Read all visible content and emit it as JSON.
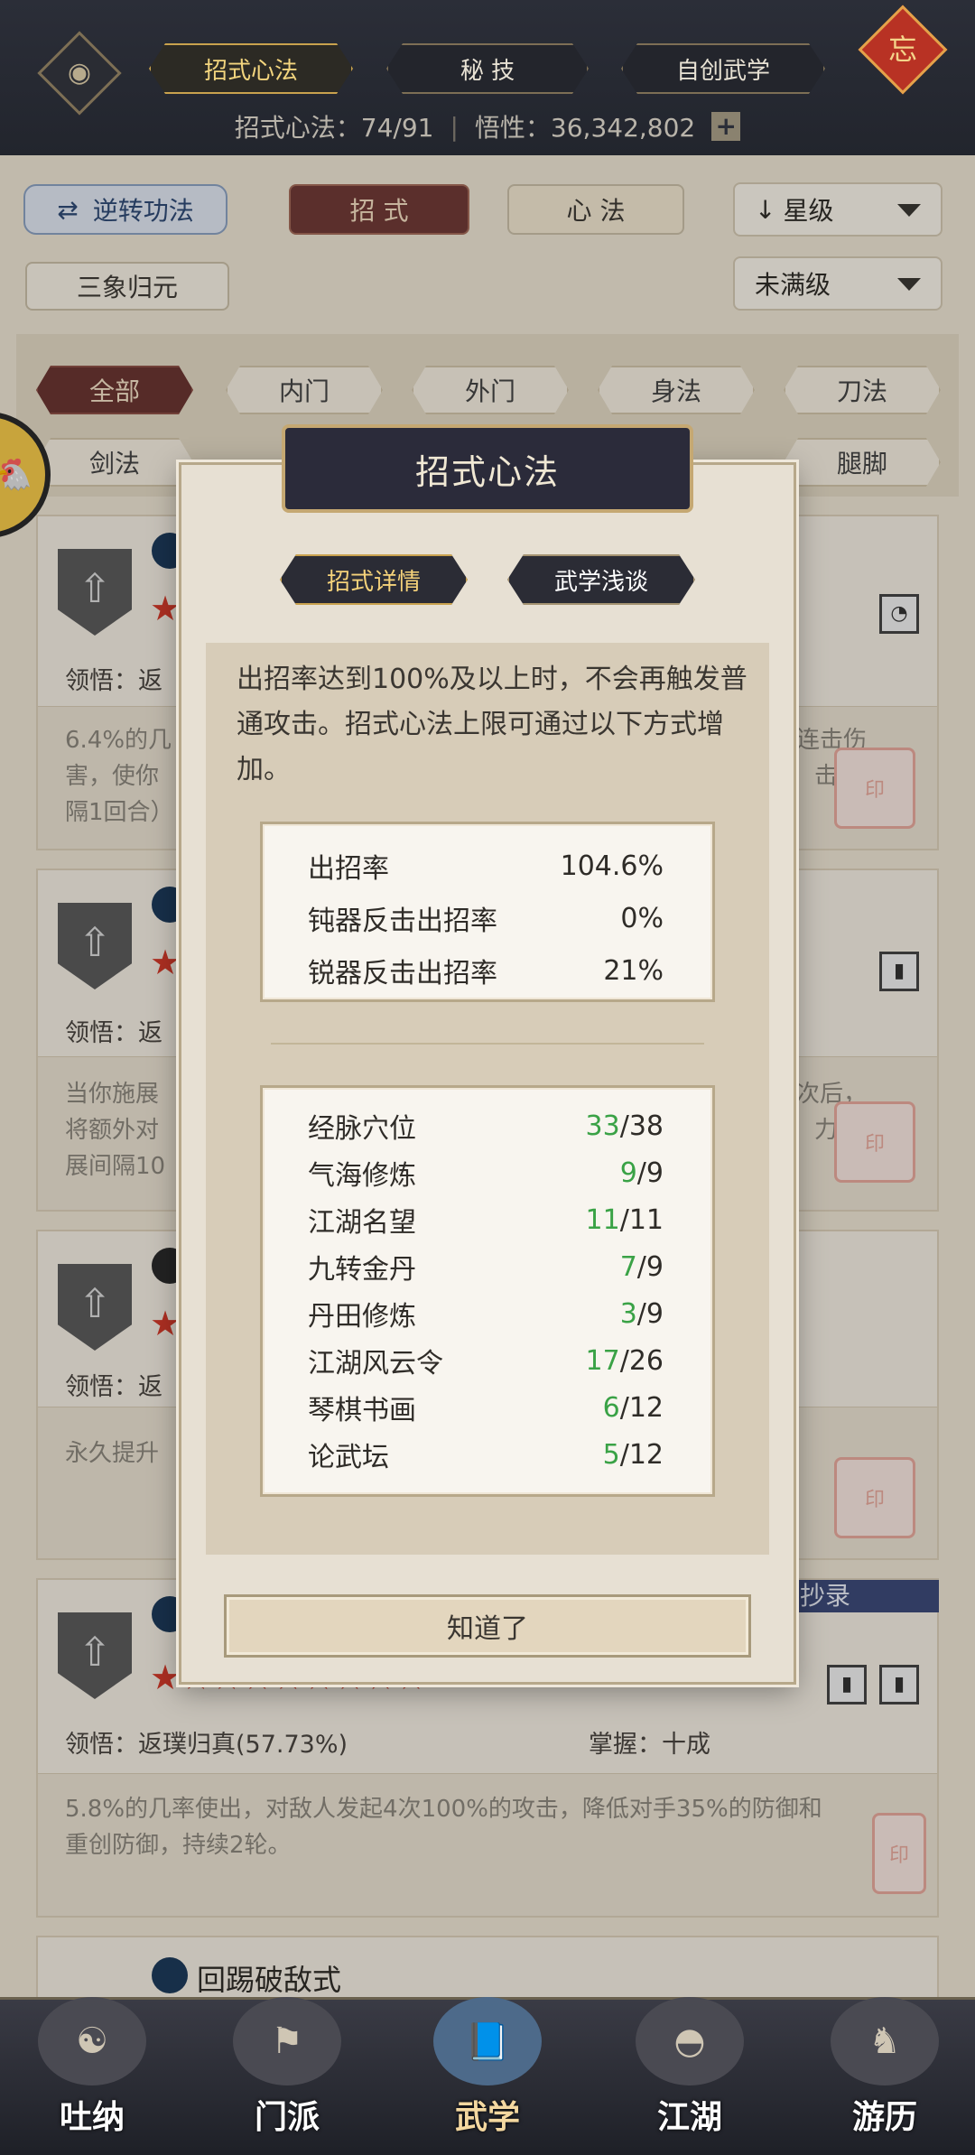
{
  "top": {
    "tabs": [
      "招式心法",
      "秘 技",
      "自创武学"
    ],
    "active_tab": "招式心法",
    "stats_label1": "招式心法：",
    "stats_value1": "74/91",
    "stats_label2": "悟性：",
    "stats_value2": "36,342,802",
    "plus": "+",
    "knot_char": "忘"
  },
  "filters": {
    "reverse_btn": "逆转功法",
    "tab_zhaoshi": "招 式",
    "tab_xinfa": "心 法",
    "sort_dd": "星级",
    "sanxiang": "三象归元",
    "level_dd": "未满级",
    "tags_row1": [
      "全部",
      "内门",
      "外门",
      "身法",
      "刀法"
    ],
    "tags_row2": [
      "剑法",
      "腿脚"
    ]
  },
  "cards": [
    {
      "understand_label": "领悟：",
      "understand_partial": "返",
      "desc": [
        "6.4%的几",
        "害，使你",
        "隔1回合）"
      ],
      "desc_right": [
        "连击伤",
        "击（间"
      ]
    },
    {
      "understand_label": "领悟：",
      "understand_partial": "返",
      "desc": [
        "当你施展",
        "将额外对",
        "展间隔10"
      ],
      "desc_right": [
        "次后，",
        "力，施"
      ]
    },
    {
      "understand_label": "领悟：",
      "understand_partial": "返",
      "desc": [
        "永久提升"
      ],
      "desc_right": []
    },
    {
      "banner": "楼已抄录",
      "understand": "领悟：返璞归真(57.73%)",
      "mastery": "掌握：十成",
      "desc": [
        "5.8%的几率使出，对敌人发起4次100%的攻击，降低对手35%的防御和",
        "重创防御，持续2轮。"
      ]
    },
    {
      "name_partial": "回踢破敌式"
    }
  ],
  "modal": {
    "title": "招式心法",
    "tab_details": "招式详情",
    "tab_talk": "武学浅谈",
    "description": "出招率达到100%及以上时，不会再触发普通攻击。招式心法上限可通过以下方式增加。",
    "rates": [
      {
        "label": "出招率",
        "value": "104.6%"
      },
      {
        "label": "钝器反击出招率",
        "value": "0%"
      },
      {
        "label": "锐器反击出招率",
        "value": "21%"
      }
    ],
    "sources": [
      {
        "label": "经脉穴位",
        "cur": "33",
        "max": "/38"
      },
      {
        "label": "气海修炼",
        "cur": "9",
        "max": "/9"
      },
      {
        "label": "江湖名望",
        "cur": "11",
        "max": "/11"
      },
      {
        "label": "九转金丹",
        "cur": "7",
        "max": "/9"
      },
      {
        "label": "丹田修炼",
        "cur": "3",
        "max": "/9"
      },
      {
        "label": "江湖风云令",
        "cur": "17",
        "max": "/26"
      },
      {
        "label": "琴棋书画",
        "cur": "6",
        "max": "/12"
      },
      {
        "label": "论武坛",
        "cur": "5",
        "max": "/12"
      }
    ],
    "ok": "知道了"
  },
  "nav": [
    "吐纳",
    "门派",
    "武学",
    "江湖",
    "游历"
  ],
  "nav_active": "武学"
}
